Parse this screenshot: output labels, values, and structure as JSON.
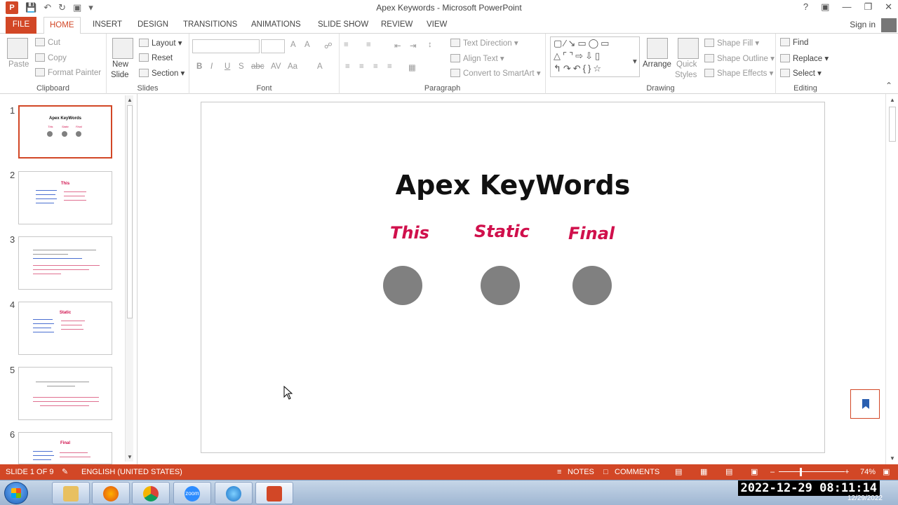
{
  "window": {
    "title": "Apex Keywords - Microsoft PowerPoint",
    "signin": "Sign in"
  },
  "tabs": [
    "FILE",
    "HOME",
    "INSERT",
    "DESIGN",
    "TRANSITIONS",
    "ANIMATIONS",
    "SLIDE SHOW",
    "REVIEW",
    "VIEW"
  ],
  "ribbon": {
    "clipboard": {
      "paste": "Paste",
      "cut": "Cut",
      "copy": "Copy",
      "format_painter": "Format Painter",
      "label": "Clipboard"
    },
    "slides": {
      "new_slide_1": "New",
      "new_slide_2": "Slide",
      "layout": "Layout",
      "reset": "Reset",
      "section": "Section",
      "label": "Slides"
    },
    "font": {
      "bold": "B",
      "italic": "I",
      "underline": "U",
      "shadow": "S",
      "strike": "abc",
      "spacing": "AV",
      "case": "Aa",
      "grow": "A",
      "shrink": "A",
      "color": "A",
      "label": "Font"
    },
    "paragraph": {
      "text_direction": "Text Direction",
      "align_text": "Align Text",
      "convert_smartart": "Convert to SmartArt",
      "label": "Paragraph"
    },
    "drawing": {
      "arrange": "Arrange",
      "quick_styles_1": "Quick",
      "quick_styles_2": "Styles",
      "shape_fill": "Shape Fill",
      "shape_outline": "Shape Outline",
      "shape_effects": "Shape Effects",
      "label": "Drawing"
    },
    "editing": {
      "find": "Find",
      "replace": "Replace",
      "select": "Select",
      "label": "Editing"
    }
  },
  "thumbnails": [
    {
      "num": "1",
      "title": "Apex KeyWords",
      "kw1": "This",
      "kw2": "Static",
      "kw3": "Final"
    },
    {
      "num": "2",
      "title": "This"
    },
    {
      "num": "3",
      "title": ""
    },
    {
      "num": "4",
      "title": "Static"
    },
    {
      "num": "5",
      "title": ""
    },
    {
      "num": "6",
      "title": "Final"
    }
  ],
  "slide": {
    "title": "Apex KeyWords",
    "kw1": "This",
    "kw2": "Static",
    "kw3": "Final"
  },
  "status": {
    "slide_of": "SLIDE 1 OF 9",
    "language": "ENGLISH (UNITED STATES)",
    "notes": "NOTES",
    "comments": "COMMENTS",
    "zoom": "74%"
  },
  "taskbar": {
    "clock": "2022-12-29  08:11:14",
    "date": "12/29/2022",
    "zoom_app": "zoom"
  },
  "colors": {
    "accent": "#d24726",
    "keyword": "#d0104c",
    "circle": "#808080"
  }
}
